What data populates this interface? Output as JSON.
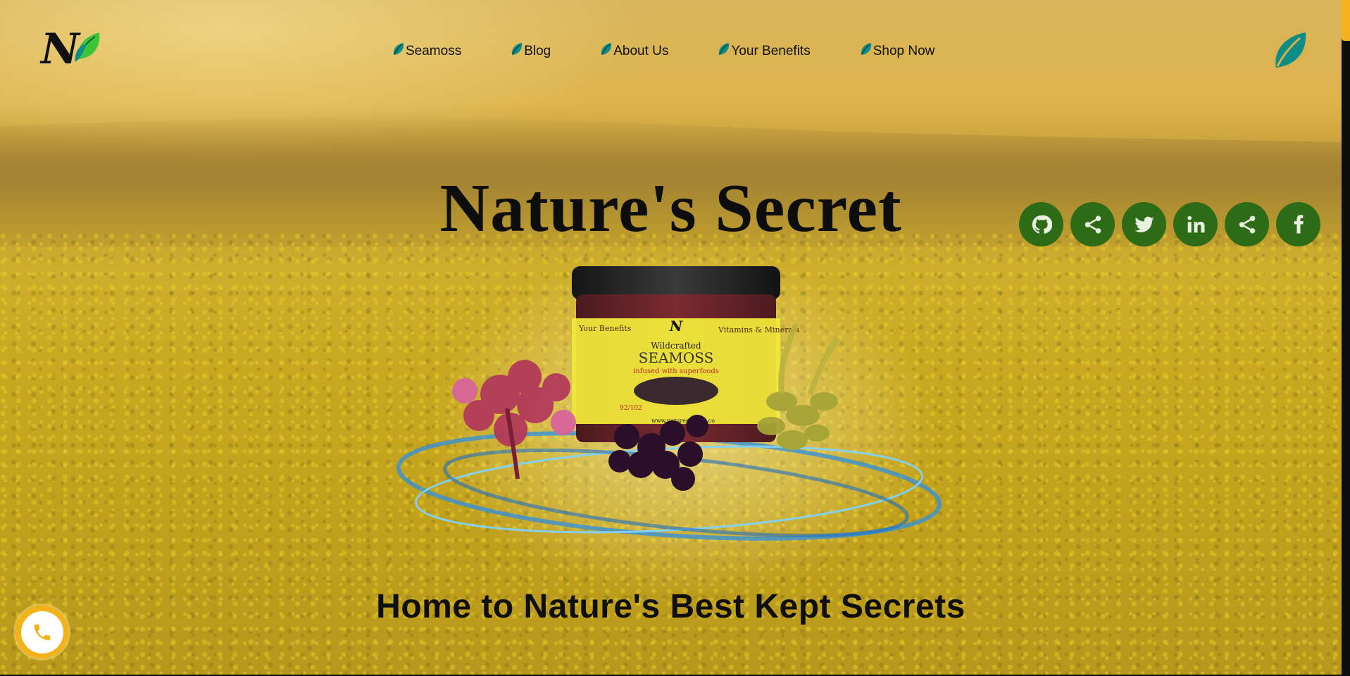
{
  "header": {
    "logo_text": "N",
    "nav": [
      {
        "label": "Seamoss"
      },
      {
        "label": "Blog"
      },
      {
        "label": "About Us"
      },
      {
        "label": "Your Benefits"
      },
      {
        "label": "Shop Now"
      }
    ],
    "nav_icon": "leaf-icon",
    "corner_icon": "leaf-logo-icon"
  },
  "hero": {
    "title": "Nature's Secret",
    "tagline": "Home to Nature's Best Kept Secrets"
  },
  "product": {
    "label_brand": "N",
    "label_line1": "Wildcrafted",
    "label_line2": "SEAMOSS",
    "label_line3": "infused with superfoods",
    "label_left_title": "Your Benefits",
    "label_right_title": "Vitamins & Minerals",
    "label_count": "92/102",
    "label_url": "www.naturessecret.co"
  },
  "social": [
    {
      "name": "github-icon"
    },
    {
      "name": "share-icon"
    },
    {
      "name": "twitter-icon"
    },
    {
      "name": "linkedin-icon"
    },
    {
      "name": "share-icon"
    },
    {
      "name": "facebook-icon"
    }
  ],
  "colors": {
    "accent": "#f3b21a",
    "social_bg": "#2e6b17",
    "leaf_teal": "#0e8c86",
    "leaf_green": "#3ec43a"
  }
}
